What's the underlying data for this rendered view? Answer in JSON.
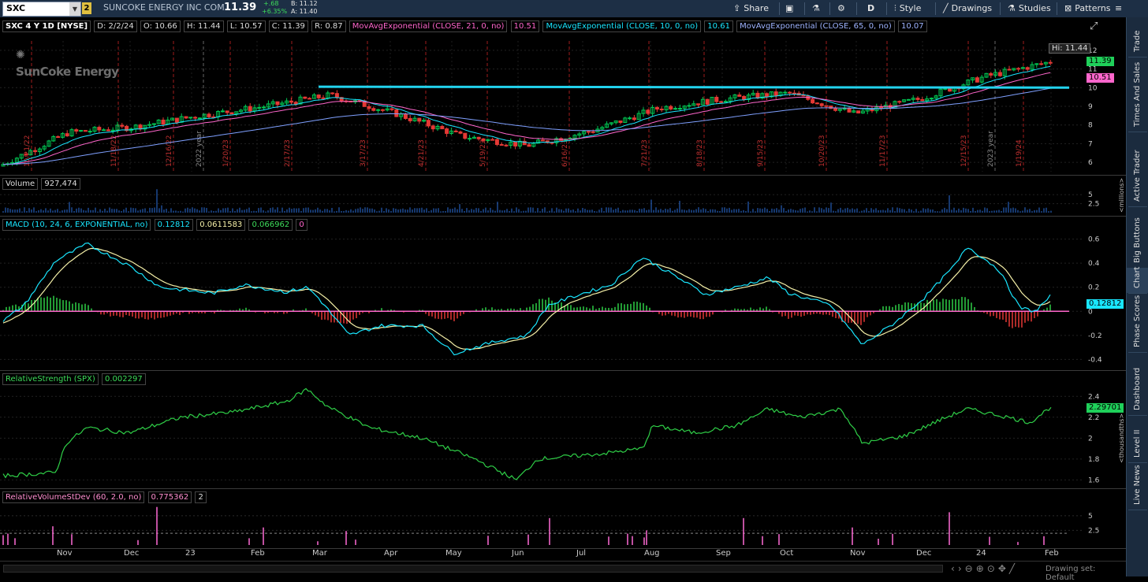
{
  "toolbar": {
    "symbol": "SXC",
    "link_badge": "2",
    "company": "SUNCOKE ENERGY INC COM",
    "last_price": "11.39",
    "change": "+.68",
    "change_pct": "+6.35%",
    "bid": "B: 11.12",
    "ask": "A: 11.40",
    "share_label": "Share",
    "period_label": "D",
    "style_label": "Style",
    "drawings_label": "Drawings",
    "studies_label": "Studies",
    "patterns_label": "Patterns"
  },
  "header": {
    "title": "SXC 4 Y 1D [NYSE]",
    "date": "D: 2/2/24",
    "open": "O: 10.66",
    "high": "H: 11.44",
    "low": "L: 10.57",
    "close": "C: 11.39",
    "range": "R: 0.87",
    "ema21_label": "MovAvgExponential (CLOSE, 21, 0, no)",
    "ema21_value": "10.51",
    "ema10_label": "MovAvgExponential (CLOSE, 10, 0, no)",
    "ema10_value": "10.61",
    "ema65_label": "MovAvgExponential (CLOSE, 65, 0, no)",
    "ema65_value": "10.07"
  },
  "watermark": "SunCoke Energy",
  "price_pane": {
    "hi_label": "Hi: 11.44",
    "last_flag": "11.39",
    "ema_flag": "10.51",
    "axis_ticks": [
      "12",
      "11",
      "10",
      "9",
      "8",
      "7",
      "6"
    ],
    "date_markers": [
      "10/21/22",
      "11/18/22",
      "12/16/22",
      "2022 year",
      "1/20/23",
      "2/17/23",
      "3/17/23",
      "4/21/23",
      "5/19/23",
      "6/16/23",
      "7/21/23",
      "8/18/23",
      "9/15/23",
      "10/20/23",
      "11/17/23",
      "12/15/23",
      "2023 year",
      "1/19/24"
    ],
    "resistance_level": 10.0,
    "colors": {
      "up": "#00c853",
      "down": "#e53935",
      "ema_fast": "#19e6ff",
      "ema_mid": "#ff66cc",
      "ema_slow": "#7fa0ff",
      "resistance": "#22d3ee"
    }
  },
  "volume_pane": {
    "label": "Volume",
    "value": "927,474",
    "axis_ticks": [
      "5",
      "2.5"
    ],
    "unit": "<millions>"
  },
  "macd_pane": {
    "label": "MACD (10, 24, 6, EXPONENTIAL, no)",
    "value": "0.12812",
    "avg": "0.0611583",
    "diff": "0.066962",
    "zero": "0",
    "axis_ticks": [
      "0.6",
      "0.4",
      "0.2",
      "0",
      "-0.2",
      "-0.4"
    ],
    "flag": "0.12812"
  },
  "rs_pane": {
    "label": "RelativeStrength (SPX)",
    "value": "0.002297",
    "axis_ticks": [
      "2.4",
      "2.2",
      "2",
      "1.8",
      "1.6"
    ],
    "flag": "2.29701",
    "unit": "<thousandths>"
  },
  "rvol_pane": {
    "label": "RelativeVolumeStDev (60, 2.0, no)",
    "value": "0.775362",
    "threshold": "2",
    "axis_ticks": [
      "5",
      "2.5"
    ]
  },
  "x_axis": {
    "months": [
      "Nov",
      "Dec",
      "23",
      "Feb",
      "Mar",
      "Apr",
      "May",
      "Jun",
      "Jul",
      "Aug",
      "Sep",
      "Oct",
      "Nov",
      "Dec",
      "24",
      "Feb"
    ]
  },
  "status": {
    "drawing_set": "Drawing set: Default"
  },
  "sidebar": {
    "tabs": [
      "Trade",
      "Times And Sales",
      "Active Trader",
      "Big Buttons",
      "Chart",
      "Phase Scores",
      "Dashboard",
      "Level II",
      "Live News"
    ]
  },
  "chart_data": {
    "type": "line",
    "title": "SXC 4 Y 1D [NYSE]",
    "x": [
      "Oct-22",
      "Nov-22",
      "Dec-22",
      "Jan-23",
      "Feb-23",
      "Mar-23",
      "Apr-23",
      "May-23",
      "Jun-23",
      "Jul-23",
      "Aug-23",
      "Sep-23",
      "Oct-23",
      "Nov-23",
      "Dec-23",
      "Jan-24",
      "Feb-24"
    ],
    "series": [
      {
        "values": [
          5.9,
          7.6,
          7.9,
          8.5,
          9.0,
          9.6,
          8.6,
          7.4,
          6.9,
          7.7,
          8.9,
          9.4,
          9.7,
          8.6,
          9.4,
          10.6,
          11.39
        ]
      }
    ],
    "ylim": [
      5.5,
      12.5
    ]
  }
}
